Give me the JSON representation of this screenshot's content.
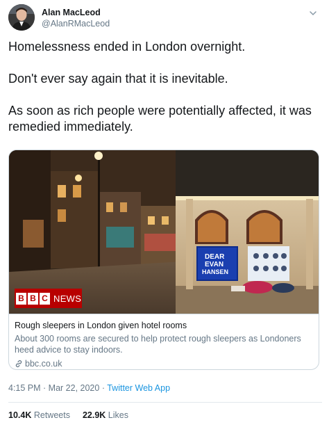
{
  "author": {
    "display_name": "Alan MacLeod",
    "handle": "@AlanRMacLeod"
  },
  "tweet": {
    "paragraphs": [
      "Homelessness ended in London overnight.",
      "Don't ever say again that it is inevitable.",
      "As soon as rich people were potentially affected, it was remedied immediately."
    ]
  },
  "card": {
    "image_logo": {
      "box_letters": [
        "B",
        "B",
        "C"
      ],
      "word": "NEWS",
      "brand_color": "#b80000"
    },
    "theatre_sign": {
      "line1": "DEAR",
      "line2": "EVAN",
      "line3": "HANSEN"
    },
    "title": "Rough sleepers in London given hotel rooms",
    "description": "About 300 rooms are secured to help protect rough sleepers as Londoners heed advice to stay indoors.",
    "domain": "bbc.co.uk",
    "link_icon": "link-icon"
  },
  "meta": {
    "time": "4:15 PM",
    "separator": " · ",
    "date": "Mar 22, 2020",
    "source": "Twitter Web App"
  },
  "stats": {
    "retweets_count": "10.4K",
    "retweets_label": "Retweets",
    "likes_count": "22.9K",
    "likes_label": "Likes"
  },
  "colors": {
    "text": "#14171a",
    "secondary": "#657786",
    "link": "#1b95e0",
    "border": "#ccd6dd"
  }
}
